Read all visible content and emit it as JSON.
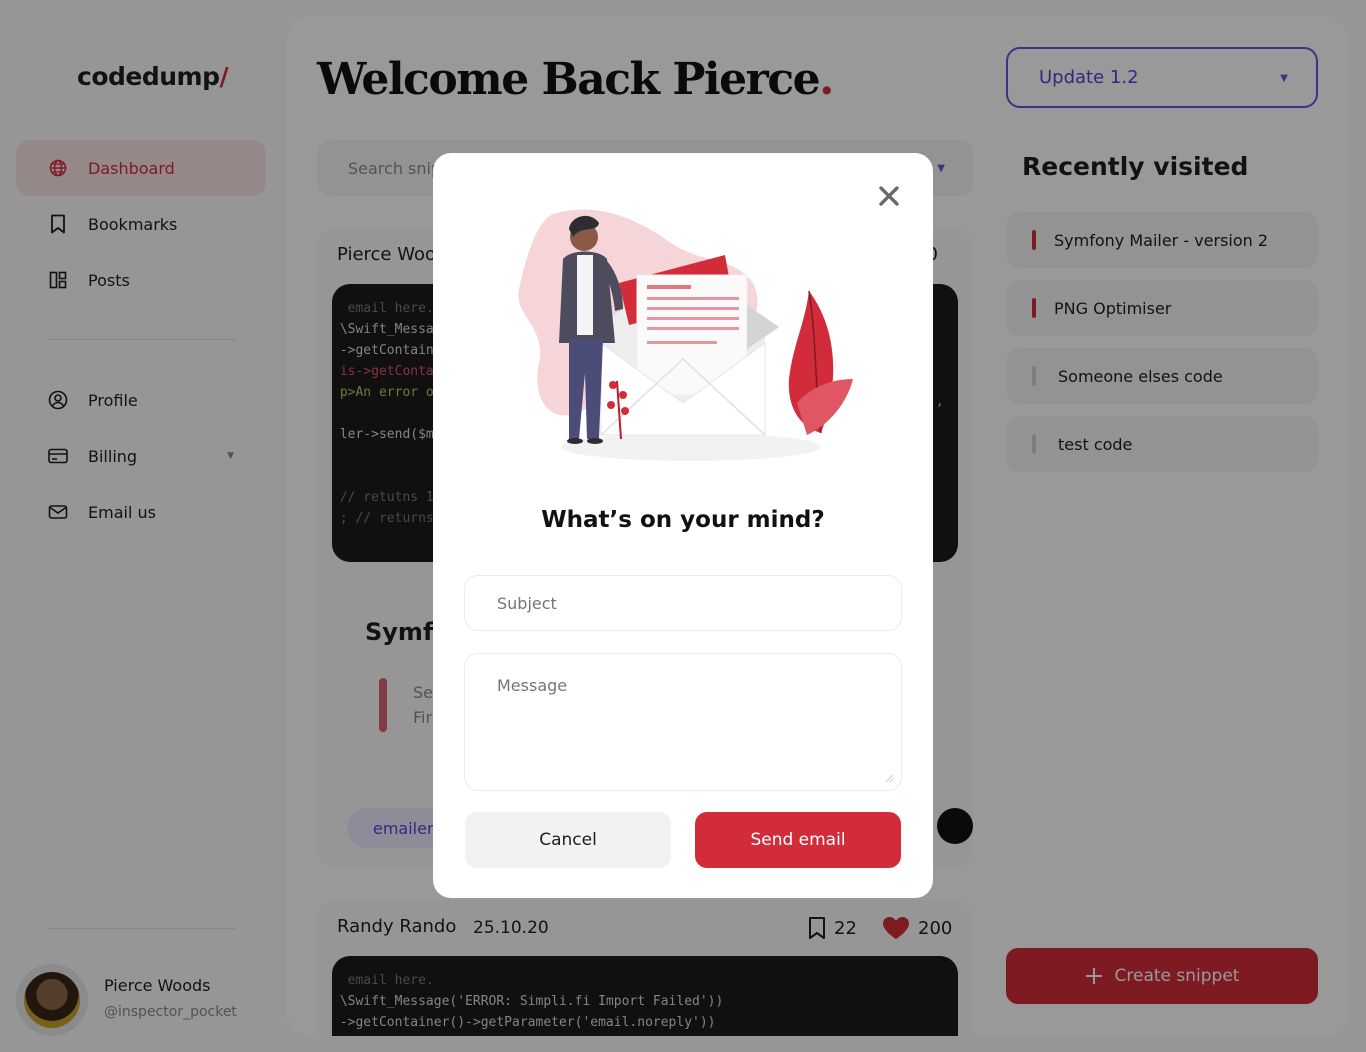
{
  "brand": {
    "logo_text": "codedump",
    "logo_slash": "/"
  },
  "sidebar": {
    "items": [
      {
        "label": "Dashboard",
        "icon": "globe-icon",
        "active": true
      },
      {
        "label": "Bookmarks",
        "icon": "bookmark-icon",
        "active": false
      },
      {
        "label": "Posts",
        "icon": "posts-icon",
        "active": false
      },
      {
        "label": "Profile",
        "icon": "user-circle-icon",
        "active": false
      },
      {
        "label": "Billing",
        "icon": "card-icon",
        "active": false,
        "has_dropdown": true
      },
      {
        "label": "Email us",
        "icon": "mail-icon",
        "active": false
      }
    ],
    "user": {
      "name": "Pierce Woods",
      "handle": "@inspector_pocket"
    }
  },
  "header": {
    "welcome_text": "Welcome Back Pierce",
    "welcome_dot": ".",
    "version_select": "Update 1.2"
  },
  "search": {
    "placeholder": "Search snip"
  },
  "feed": {
    "card1": {
      "author": "Pierce Woo",
      "likes_partial": "00",
      "code_lines": [
        "  email here.",
        " \\Swift_Messa",
        " ->getContaine",
        " is->getConta",
        " p>An error o",
        "",
        " ler->send($me",
        "",
        "",
        " // retutns 1",
        " ; // returns"
      ],
      "code_right": "',",
      "title": "Symf",
      "sub_line1": "Se",
      "sub_line2": "Firs",
      "tag": "emailer"
    },
    "card2": {
      "author": "Randy Rando",
      "date": "25.10.20",
      "bookmarks": "22",
      "likes": "200",
      "code_lines": [
        "  email here.",
        " \\Swift_Message('ERROR: Simpli.fi Import Failed'))",
        " ->getContainer()->getParameter('email.noreply'))"
      ]
    }
  },
  "recent": {
    "title": "Recently visited",
    "items": [
      {
        "label": "Symfony Mailer - version 2",
        "accent": "red"
      },
      {
        "label": "PNG Optimiser",
        "accent": "red"
      },
      {
        "label": "Someone elses code",
        "accent": "grey"
      },
      {
        "label": "test code",
        "accent": "grey"
      }
    ]
  },
  "create_button": {
    "label": "Create snippet",
    "icon": "plus-icon"
  },
  "modal": {
    "title": "What’s on your mind?",
    "subject_placeholder": "Subject",
    "message_placeholder": "Message",
    "cancel_label": "Cancel",
    "send_label": "Send email",
    "close_icon": "close-icon"
  },
  "colors": {
    "accent": "#d22c3a",
    "accent_soft": "#f7e3e5",
    "purple": "#6c53e0",
    "overlay": "rgba(0,0,0,0.40)"
  }
}
